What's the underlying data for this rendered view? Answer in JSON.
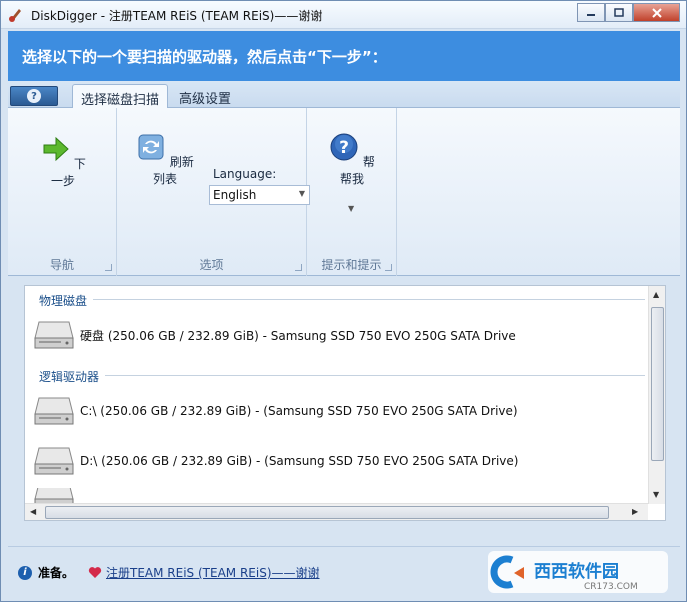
{
  "window": {
    "title": "DiskDigger - 注册TEAM REiS (TEAM REiS)——谢谢",
    "controls": [
      "minimize",
      "maximize",
      "close"
    ]
  },
  "header": {
    "instruction": "选择以下的一个要扫描的驱动器，然后点击“下一步”："
  },
  "tabs": {
    "help_icon": "help-icon",
    "items": [
      {
        "label": "选择磁盘扫描",
        "active": true
      },
      {
        "label": "高级设置",
        "active": false
      }
    ]
  },
  "ribbon": {
    "groups": [
      {
        "label": "导航",
        "buttons": [
          {
            "label": "下一步",
            "icon": "next-arrow-icon"
          }
        ]
      },
      {
        "label": "选项",
        "buttons": [
          {
            "label": "刷新列表",
            "icon": "refresh-icon"
          }
        ],
        "language_label": "Language:",
        "language_value": "English"
      },
      {
        "label": "提示和提示",
        "buttons": [
          {
            "label": "帮帮我",
            "icon": "help-icon"
          }
        ]
      }
    ]
  },
  "list": {
    "sections": [
      {
        "title": "物理磁盘",
        "drives": [
          {
            "label": "硬盘 (250.06 GB / 232.89 GiB) - Samsung SSD 750 EVO 250G SATA Drive"
          }
        ]
      },
      {
        "title": "逻辑驱动器",
        "drives": [
          {
            "label": "C:\\ (250.06 GB / 232.89 GiB) -  (Samsung SSD 750 EVO 250G SATA Drive)"
          },
          {
            "label": "D:\\ (250.06 GB / 232.89 GiB) -  (Samsung SSD 750 EVO 250G SATA Drive)"
          },
          {
            "label": ""
          }
        ]
      }
    ]
  },
  "status": {
    "text": "准备。",
    "link": "注册TEAM REiS (TEAM REiS)——谢谢"
  },
  "watermark": {
    "text": "西西软件园",
    "sub": "CR173.COM"
  },
  "colors": {
    "header_bg": "#3d8de0",
    "window_bg": "#d7e4f2",
    "accent": "#1d5fae"
  }
}
